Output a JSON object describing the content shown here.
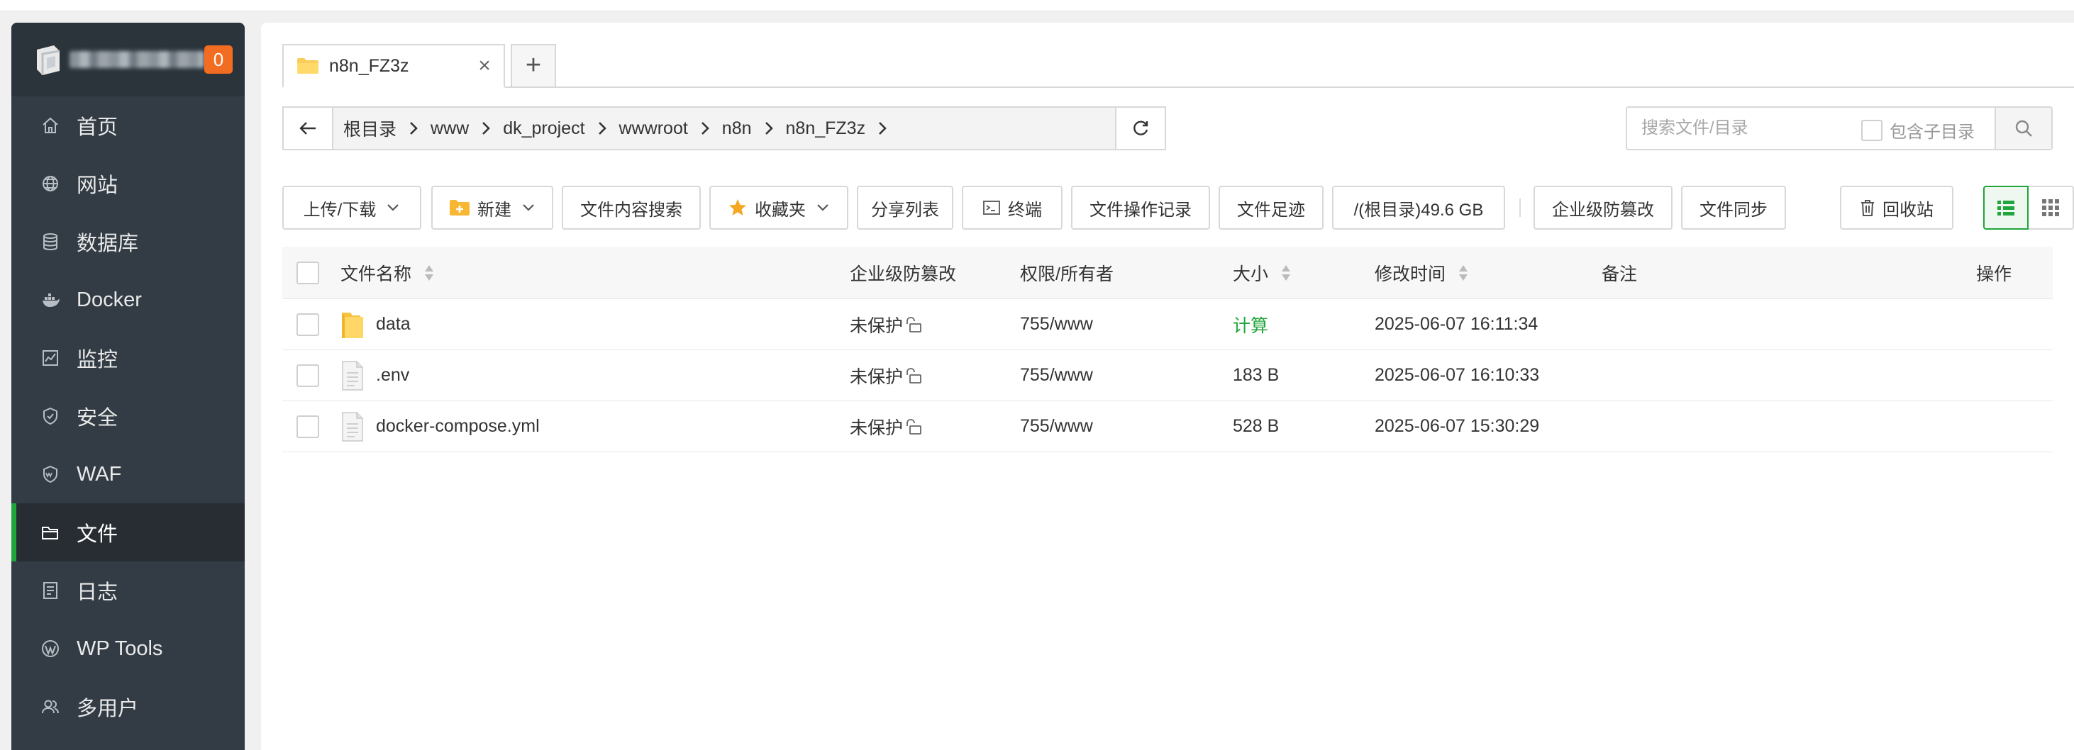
{
  "sidebar": {
    "notice_count": "0",
    "items": [
      {
        "label": "首页",
        "icon": "home-icon"
      },
      {
        "label": "网站",
        "icon": "globe-icon"
      },
      {
        "label": "数据库",
        "icon": "database-icon"
      },
      {
        "label": "Docker",
        "icon": "docker-icon"
      },
      {
        "label": "监控",
        "icon": "monitor-icon"
      },
      {
        "label": "安全",
        "icon": "shield-icon"
      },
      {
        "label": "WAF",
        "icon": "waf-shield-icon"
      },
      {
        "label": "文件",
        "icon": "folder-icon",
        "active": true
      },
      {
        "label": "日志",
        "icon": "log-icon"
      },
      {
        "label": "WP Tools",
        "icon": "wordpress-icon"
      },
      {
        "label": "多用户",
        "icon": "users-icon"
      }
    ]
  },
  "tabs": {
    "current": "n8n_FZ3z"
  },
  "path": {
    "crumbs": [
      "根目录",
      "www",
      "dk_project",
      "wwwroot",
      "n8n",
      "n8n_FZ3z"
    ]
  },
  "search": {
    "placeholder": "搜索文件/目录",
    "subdir_label": "包含子目录"
  },
  "toolbar": {
    "upload_download": "上传/下载",
    "new": "新建",
    "content_search": "文件内容搜索",
    "favorites": "收藏夹",
    "share_list": "分享列表",
    "terminal": "终端",
    "operation_log": "文件操作记录",
    "file_trace": "文件足迹",
    "disk_usage": "/(根目录)49.6 GB",
    "tamper_proof": "企业级防篡改",
    "file_sync": "文件同步",
    "recycle_bin": "回收站"
  },
  "table": {
    "headers": {
      "name": "文件名称",
      "tamper": "企业级防篡改",
      "perm": "权限/所有者",
      "size": "大小",
      "mtime": "修改时间",
      "note": "备注",
      "action": "操作"
    },
    "rows": [
      {
        "name": "data",
        "type": "folder",
        "protect": "未保护",
        "perm": "755/www",
        "size": "计算",
        "mtime": "2025-06-07 16:11:34",
        "note": ""
      },
      {
        "name": ".env",
        "type": "file",
        "protect": "未保护",
        "perm": "755/www",
        "size": "183 B",
        "mtime": "2025-06-07 16:10:33",
        "note": ""
      },
      {
        "name": "docker-compose.yml",
        "type": "file",
        "protect": "未保护",
        "perm": "755/www",
        "size": "528 B",
        "mtime": "2025-06-07 15:30:29",
        "note": ""
      }
    ]
  },
  "colors": {
    "accent": "#20a53a",
    "sidebar_bg": "#333c45",
    "badge": "#f26d21"
  }
}
